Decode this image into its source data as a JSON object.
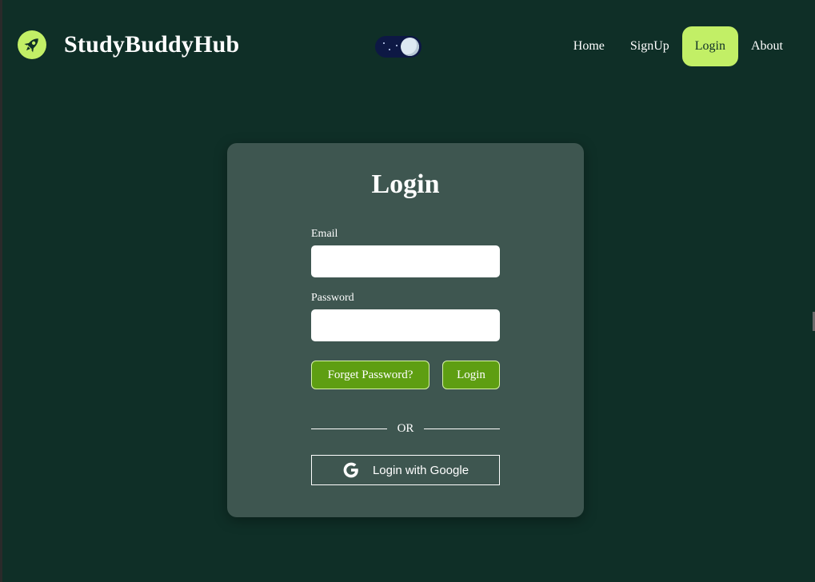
{
  "app": {
    "brand_name": "StudyBuddyHub",
    "brand_icon": "rocket-icon",
    "theme_toggle_icon": "moon-icon",
    "accent_color": "#c2ef66",
    "background_color": "#0f2f27"
  },
  "nav": {
    "items": [
      {
        "label": "Home",
        "active": false
      },
      {
        "label": "SignUp",
        "active": false
      },
      {
        "label": "Login",
        "active": true
      },
      {
        "label": "About",
        "active": false
      }
    ]
  },
  "login": {
    "title": "Login",
    "email_label": "Email",
    "email_value": "",
    "password_label": "Password",
    "password_value": "",
    "forgot_label": "Forget Password?",
    "submit_label": "Login",
    "divider_text": "OR",
    "google_label": "Login with Google",
    "google_icon": "google-icon",
    "button_color": "#5e9e12",
    "card_color": "#3e5650"
  }
}
